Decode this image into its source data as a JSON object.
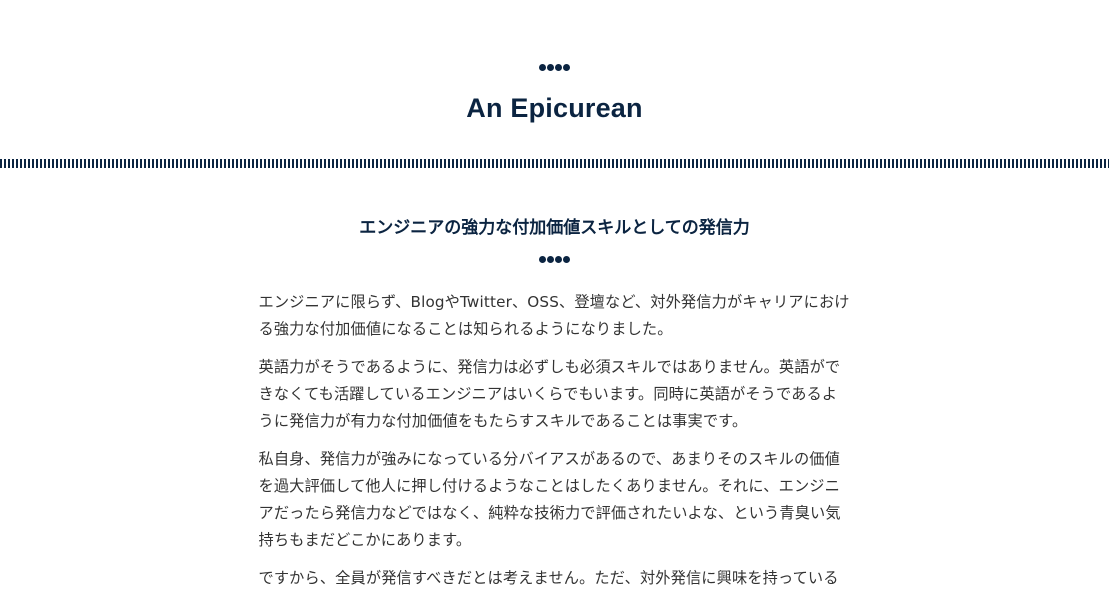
{
  "header": {
    "site_title": "An Epicurean"
  },
  "article": {
    "title": "エンジニアの強力な付加価値スキルとしての発信力",
    "paragraphs": [
      "エンジニアに限らず、BlogやTwitter、OSS、登壇など、対外発信力がキャリアにおける強力な付加価値になることは知られるようになりました。",
      "英語力がそうであるように、発信力は必ずしも必須スキルではありません。英語ができなくても活躍しているエンジニアはいくらでもいます。同時に英語がそうであるように発信力が有力な付加価値をもたらすスキルであることは事実です。",
      "私自身、発信力が強みになっている分バイアスがあるので、あまりそのスキルの価値を過大評価して他人に押し付けるようなことはしたくありません。それに、エンジニアだったら発信力などではなく、純粋な技術力で評価されたいよな、という青臭い気持ちもまだどこかにあります。",
      "ですから、全員が発信すべきだとは考えません。ただ、対外発信に興味を持っている"
    ]
  },
  "colors": {
    "brand": "#0b2441",
    "text": "#333333",
    "background": "#ffffff"
  }
}
